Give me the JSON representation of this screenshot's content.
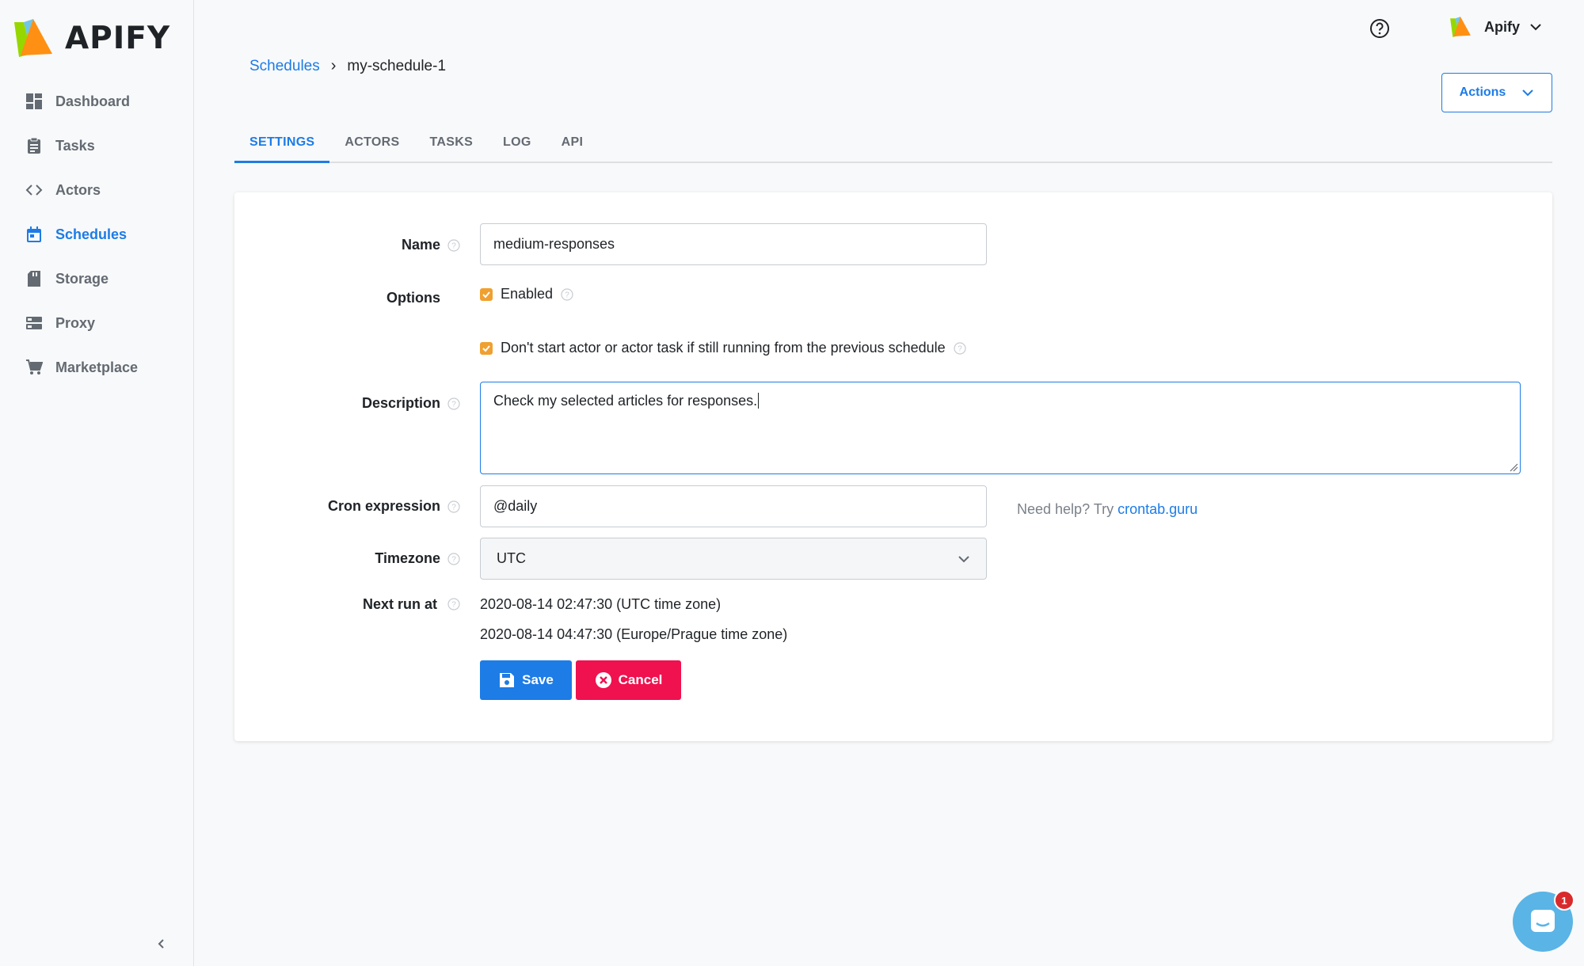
{
  "brand": {
    "name": "APIFY"
  },
  "sidebar": {
    "items": [
      {
        "label": "Dashboard",
        "icon": "dashboard-icon"
      },
      {
        "label": "Tasks",
        "icon": "clipboard-icon"
      },
      {
        "label": "Actors",
        "icon": "code-icon"
      },
      {
        "label": "Schedules",
        "icon": "calendar-icon",
        "active": true
      },
      {
        "label": "Storage",
        "icon": "storage-icon"
      },
      {
        "label": "Proxy",
        "icon": "server-icon"
      },
      {
        "label": "Marketplace",
        "icon": "cart-icon"
      }
    ],
    "collapse": "‹"
  },
  "header": {
    "account_name": "Apify",
    "actions_label": "Actions"
  },
  "breadcrumb": {
    "parent": "Schedules",
    "separator": "›",
    "current": "my-schedule-1"
  },
  "tabs": [
    {
      "label": "SETTINGS",
      "active": true
    },
    {
      "label": "ACTORS"
    },
    {
      "label": "TASKS"
    },
    {
      "label": "LOG"
    },
    {
      "label": "API"
    }
  ],
  "form": {
    "name_label": "Name",
    "name_value": "medium-responses",
    "options_label": "Options",
    "option_enabled": "Enabled",
    "option_no_overlap": "Don't start actor or actor task if still running from the previous schedule",
    "description_label": "Description",
    "description_value": "Check my selected articles for responses.",
    "cron_label": "Cron expression",
    "cron_value": "@daily",
    "cron_help_prefix": "Need help? Try ",
    "cron_help_link": "crontab.guru",
    "timezone_label": "Timezone",
    "timezone_value": "UTC",
    "next_run_label": "Next run at",
    "next_run_utc": "2020-08-14 02:47:30 (UTC time zone)",
    "next_run_local": "2020-08-14 04:47:30 (Europe/Prague time zone)",
    "save_label": "Save",
    "cancel_label": "Cancel"
  },
  "chat": {
    "badge": "1"
  },
  "colors": {
    "accent": "#1d7ce6",
    "danger": "#f0114f",
    "checkbox": "#f0a030"
  }
}
